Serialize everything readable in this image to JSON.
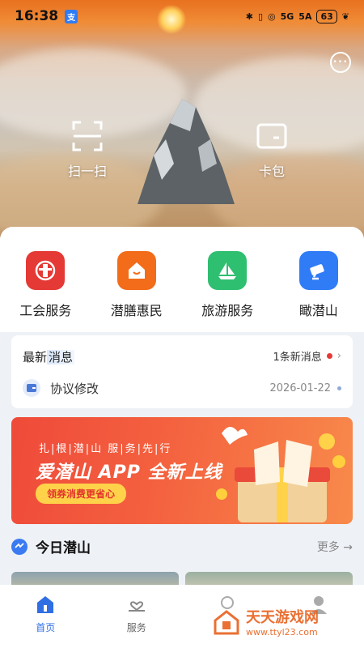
{
  "status_bar": {
    "time": "16:38",
    "app_badge": "支",
    "signal_1": "5G",
    "signal_2": "5A",
    "battery": "63"
  },
  "quick_actions": [
    {
      "label": "扫一扫",
      "icon": "scan-icon"
    },
    {
      "label": "卡包",
      "icon": "card-wallet-icon"
    }
  ],
  "services": [
    {
      "label": "工会服务",
      "icon": "union-icon",
      "color": "#e53935"
    },
    {
      "label": "潜膳惠民",
      "icon": "house-smile-icon",
      "color": "#f26c1a"
    },
    {
      "label": "旅游服务",
      "icon": "sailboat-icon",
      "color": "#2fbf71"
    },
    {
      "label": "瞰潜山",
      "icon": "camera-icon",
      "color": "#2f7cf6"
    }
  ],
  "news": {
    "heading_1": "最新",
    "heading_2": "消息",
    "count_text": "1条新消息",
    "item": {
      "title": "协议修改",
      "date": "2026-01-22"
    }
  },
  "banner": {
    "top_text": "扎|根|潜|山  服|务|先|行",
    "main_text": "爱潜山 APP 全新上线",
    "pill_text": "领券消费更省心"
  },
  "today": {
    "title": "今日潜山",
    "more": "更多"
  },
  "tabs": [
    {
      "label": "首页",
      "icon": "home-icon",
      "active": true
    },
    {
      "label": "服务",
      "icon": "heart-hand-icon",
      "active": false
    },
    {
      "label": "",
      "icon": "hidden-icon",
      "active": false
    },
    {
      "label": "",
      "icon": "profile-icon",
      "active": false
    }
  ],
  "watermark": {
    "title": "天天游戏网",
    "url": "www.ttyl23.com"
  },
  "colors": {
    "accent": "#2f6fe3",
    "red_dot": "#e53935",
    "banner_red": "#ef4a3a"
  }
}
